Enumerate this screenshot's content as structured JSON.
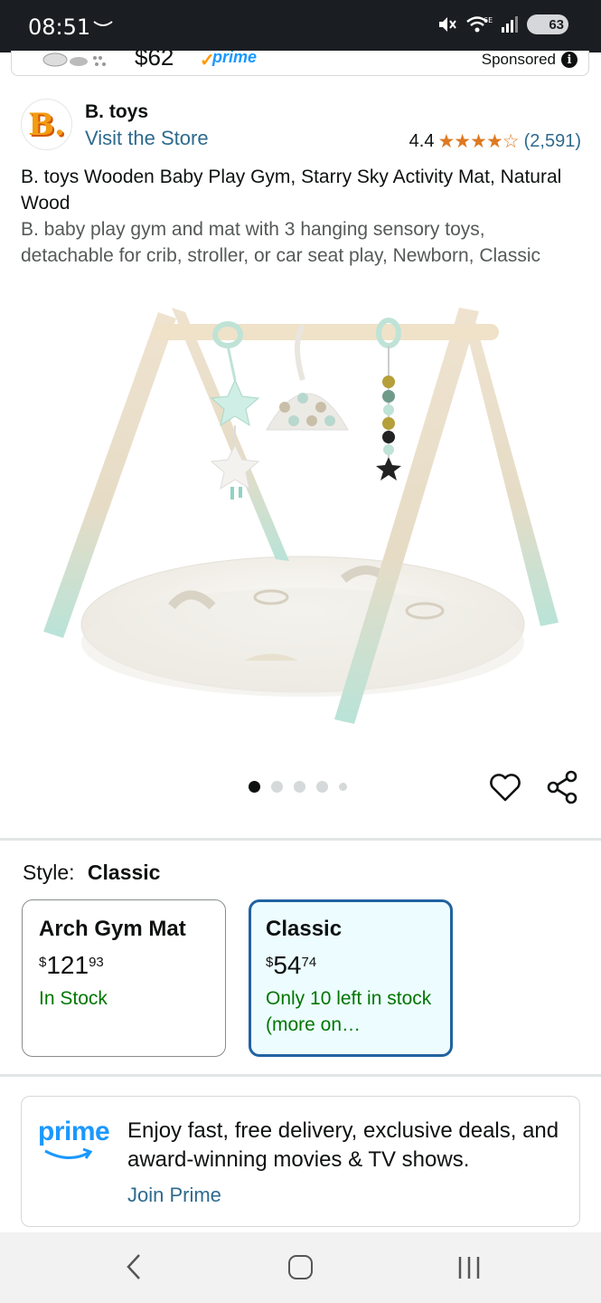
{
  "status_bar": {
    "time": "08:51",
    "network": "6E",
    "battery": "63"
  },
  "sponsored_strip": {
    "price": "$62",
    "prime": "prime",
    "label": "Sponsored"
  },
  "brand": {
    "logo_letter": "B.",
    "name": "B. toys",
    "visit_store": "Visit the Store"
  },
  "rating": {
    "value": "4.4",
    "stars": "★★★★☆",
    "count": "(2,591)"
  },
  "product": {
    "title": "B. toys Wooden Baby Play Gym, Starry Sky Activity Mat, Natural Wood",
    "description": "B. baby play gym and mat with 3 hanging sensory toys, detachable for crib, stroller, or car seat play, Newborn, Classic",
    "image_alt": "wooden baby play gym with hanging toys over a round mat",
    "image_count": 5,
    "active_image": 1
  },
  "style_selector": {
    "label": "Style:",
    "selected": "Classic",
    "options": [
      {
        "name": "Arch Gym Mat",
        "currency": "$",
        "dollars": "121",
        "cents": "93",
        "stock": "In Stock",
        "selected": false
      },
      {
        "name": "Classic",
        "currency": "$",
        "dollars": "54",
        "cents": "74",
        "stock": "Only 10 left in stock (more on…",
        "selected": true
      }
    ]
  },
  "prime_banner": {
    "logo": "prime",
    "text": "Enjoy fast, free delivery, exclusive deals, and award-winning movies & TV shows.",
    "link": "Join Prime"
  },
  "colors": {
    "link": "#2e6a8e",
    "star": "#de7921",
    "in_stock": "#007600",
    "selected_border": "#2162a1",
    "prime_blue": "#1a98ff"
  },
  "icons": [
    "mute-icon",
    "wifi-icon",
    "signal-icon",
    "battery-icon",
    "info-icon",
    "heart-icon",
    "share-icon",
    "back-icon",
    "home-icon",
    "recent-apps-icon"
  ]
}
